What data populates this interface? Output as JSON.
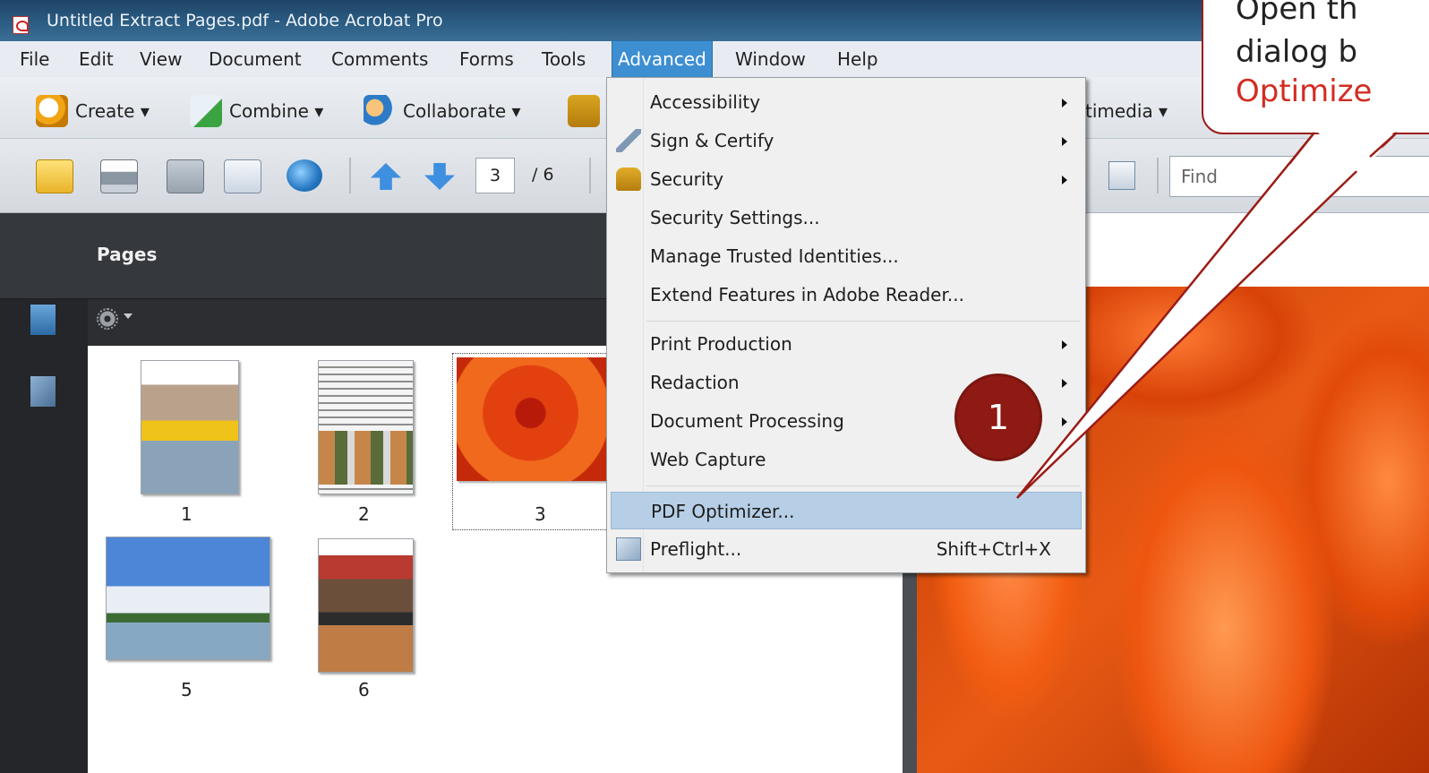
{
  "window": {
    "title": "Untitled Extract Pages.pdf - Adobe Acrobat Pro"
  },
  "menubar": [
    "File",
    "Edit",
    "View",
    "Document",
    "Comments",
    "Forms",
    "Tools",
    "Advanced",
    "Window",
    "Help"
  ],
  "toolbar1": {
    "create": "Create ▾",
    "combine": "Combine ▾",
    "collaborate": "Collaborate ▾",
    "multimedia": "timedia ▾"
  },
  "toolbar2": {
    "page_current": "3",
    "page_total": "/ 6",
    "find_placeholder": "Find"
  },
  "pages_panel": {
    "title": "Pages",
    "thumbnails": [
      "1",
      "2",
      "3",
      "5",
      "6"
    ]
  },
  "advanced_menu": {
    "items": [
      {
        "label": "Accessibility",
        "submenu": true
      },
      {
        "label": "Sign & Certify",
        "submenu": true,
        "icon": "pen-icon"
      },
      {
        "label": "Security",
        "submenu": true,
        "icon": "lock-icon"
      },
      {
        "label": "Security Settings...",
        "submenu": false
      },
      {
        "label": "Manage Trusted Identities...",
        "submenu": false
      },
      {
        "label": "Extend Features in Adobe Reader...",
        "submenu": false
      },
      {
        "label": "Print Production",
        "submenu": true
      },
      {
        "label": "Redaction",
        "submenu": true
      },
      {
        "label": "Document Processing",
        "submenu": true
      },
      {
        "label": "Web Capture",
        "submenu": false
      },
      {
        "label": "PDF Optimizer...",
        "submenu": false,
        "highlighted": true
      },
      {
        "label": "Preflight...",
        "submenu": false,
        "icon": "preflight-icon",
        "shortcut": "Shift+Ctrl+X"
      }
    ]
  },
  "callout": {
    "line1": "Open th",
    "line2": "dialog b",
    "line3": "Optimize"
  },
  "step_badge": "1",
  "colors": {
    "accent_red": "#d32c22",
    "badge": "#8e1a13",
    "menu_highlight": "#b7cfe6",
    "active_menu": "#3d8fd1"
  }
}
